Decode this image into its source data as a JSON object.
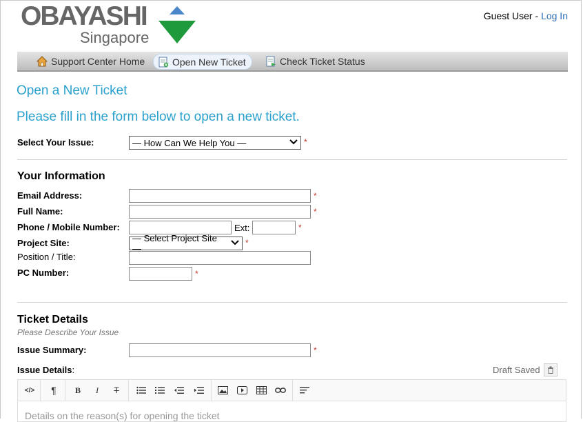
{
  "header": {
    "logo_name": "OBAYASHI",
    "logo_sub": "Singapore",
    "user": "Guest User",
    "separator": " - ",
    "login": "Log In"
  },
  "nav": {
    "home": "Support Center Home",
    "open": "Open New Ticket",
    "status": "Check Ticket Status"
  },
  "page": {
    "title": "Open a New Ticket",
    "subtitle": "Please fill in the form below to open a new ticket."
  },
  "issue": {
    "label": "Select Your Issue:",
    "selected": "— How Can We Help You —"
  },
  "info": {
    "heading": "Your Information",
    "email_label": "Email Address:",
    "name_label": "Full Name:",
    "phone_label": "Phone / Mobile Number:",
    "ext_label": "Ext:",
    "site_label": "Project Site:",
    "site_selected": "— Select Project Site —",
    "position_label": "Position / Title:",
    "pc_label": "PC Number:"
  },
  "details": {
    "heading": "Ticket Details",
    "note": "Please Describe Your Issue",
    "summary_label": "Issue Summary:",
    "details_label": "Issue Details",
    "details_colon": ":",
    "draft": "Draft Saved",
    "placeholder": "Details on the reason(s) for opening the ticket"
  },
  "required_mark": "*",
  "colors": {
    "accent": "#2aa0cc",
    "link": "#2c6fb5",
    "required": "#c0392b"
  }
}
